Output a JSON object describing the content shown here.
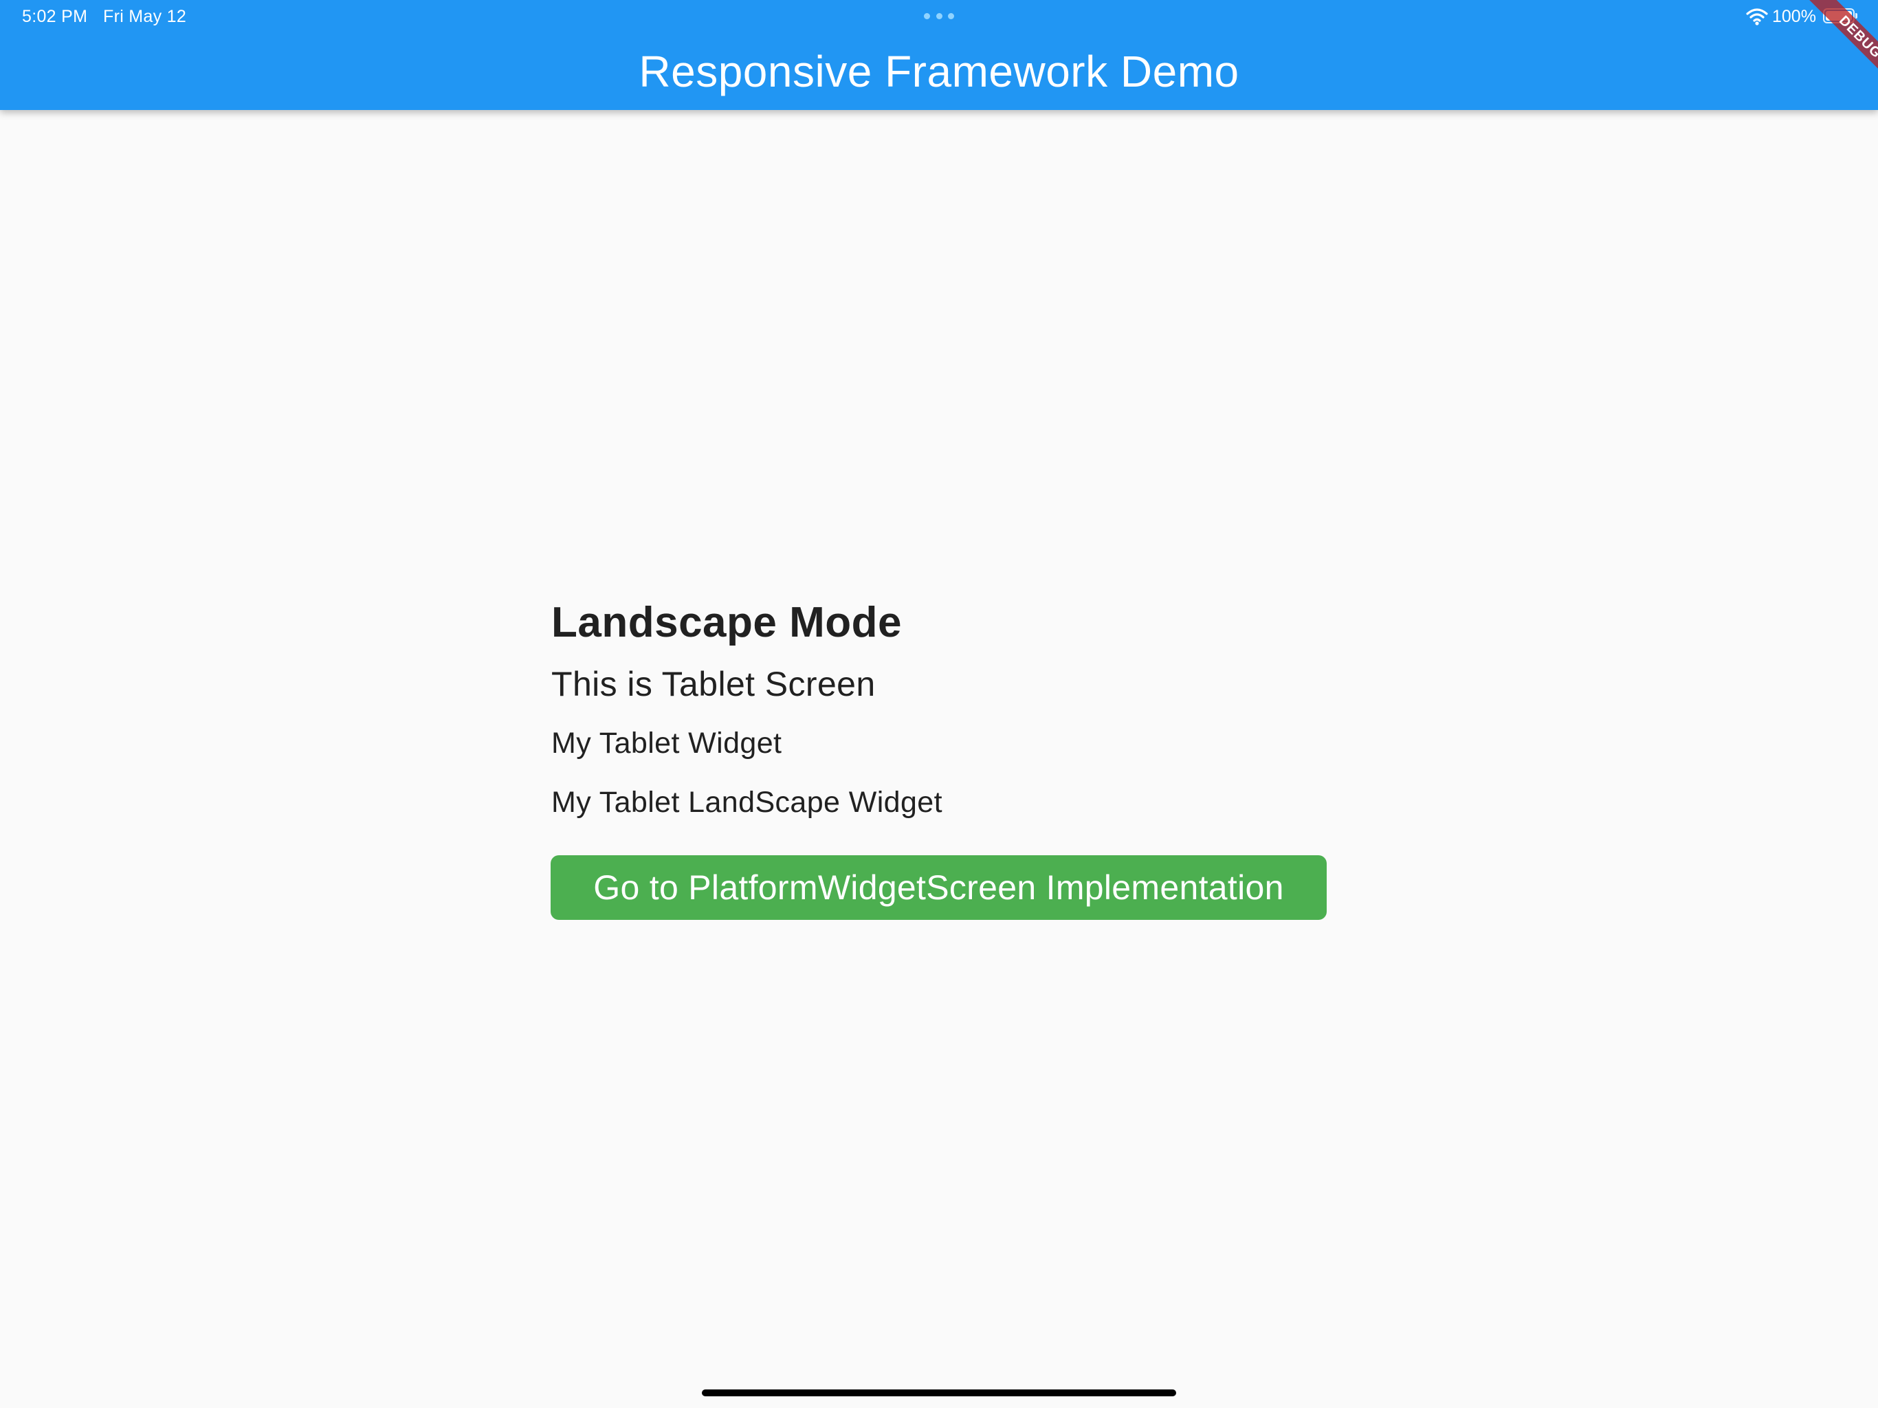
{
  "status_bar": {
    "time": "5:02 PM",
    "date": "Fri May 12",
    "battery_percent": "100%",
    "battery_level": 1.0,
    "icons": [
      "multitask-dots-icon",
      "wifi-icon",
      "battery-icon"
    ]
  },
  "app_bar": {
    "title": "Responsive Framework Demo",
    "background_color": "#2196F3",
    "title_color": "#FFFFFF"
  },
  "debug_banner": {
    "label": "DEBUG",
    "color": "#B71C1C"
  },
  "main": {
    "heading": "Landscape Mode",
    "subheading": "This is Tablet Screen",
    "widget_line_1": "My Tablet Widget",
    "widget_line_2": "My Tablet LandScape Widget",
    "action_button_label": "Go to PlatformWidgetScreen Implementation",
    "action_button_color": "#4CAF50",
    "text_color": "#212121"
  },
  "background_color": "#FAFAFA"
}
